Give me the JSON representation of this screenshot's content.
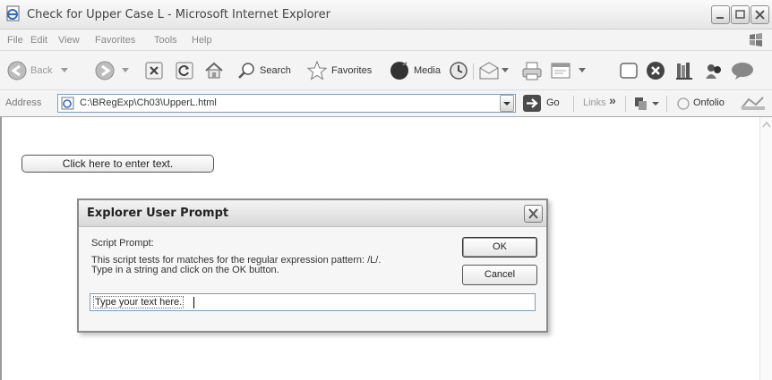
{
  "window": {
    "title": "Check for Upper Case L - Microsoft Internet Explorer",
    "icon": "ie-page-icon"
  },
  "menu": {
    "items": [
      "File",
      "Edit",
      "View",
      "Favorites",
      "Tools",
      "Help"
    ]
  },
  "toolbar": {
    "back_label": "Back",
    "search_label": "Search",
    "favorites_label": "Favorites",
    "media_label": "Media"
  },
  "address": {
    "label": "Address",
    "url": "C:\\BRegExp\\Ch03\\UpperL.html",
    "go_label": "Go",
    "links_label": "Links",
    "links_chevron": "»",
    "onfolio_label": "Onfolio"
  },
  "page": {
    "enter_button_label": "Click here to enter text."
  },
  "dialog": {
    "title": "Explorer User Prompt",
    "caption": "Script Prompt:",
    "message_line1": "This script tests for matches for the regular expression pattern: /L/.",
    "message_line2": "Type in a string and click on the OK button.",
    "ok_label": "OK",
    "cancel_label": "Cancel",
    "input_value": "Type your text here."
  },
  "colors": {
    "accent_blue": "#3a76c4",
    "favorites_star": "#e2b400",
    "close_red": "#d0342c"
  }
}
